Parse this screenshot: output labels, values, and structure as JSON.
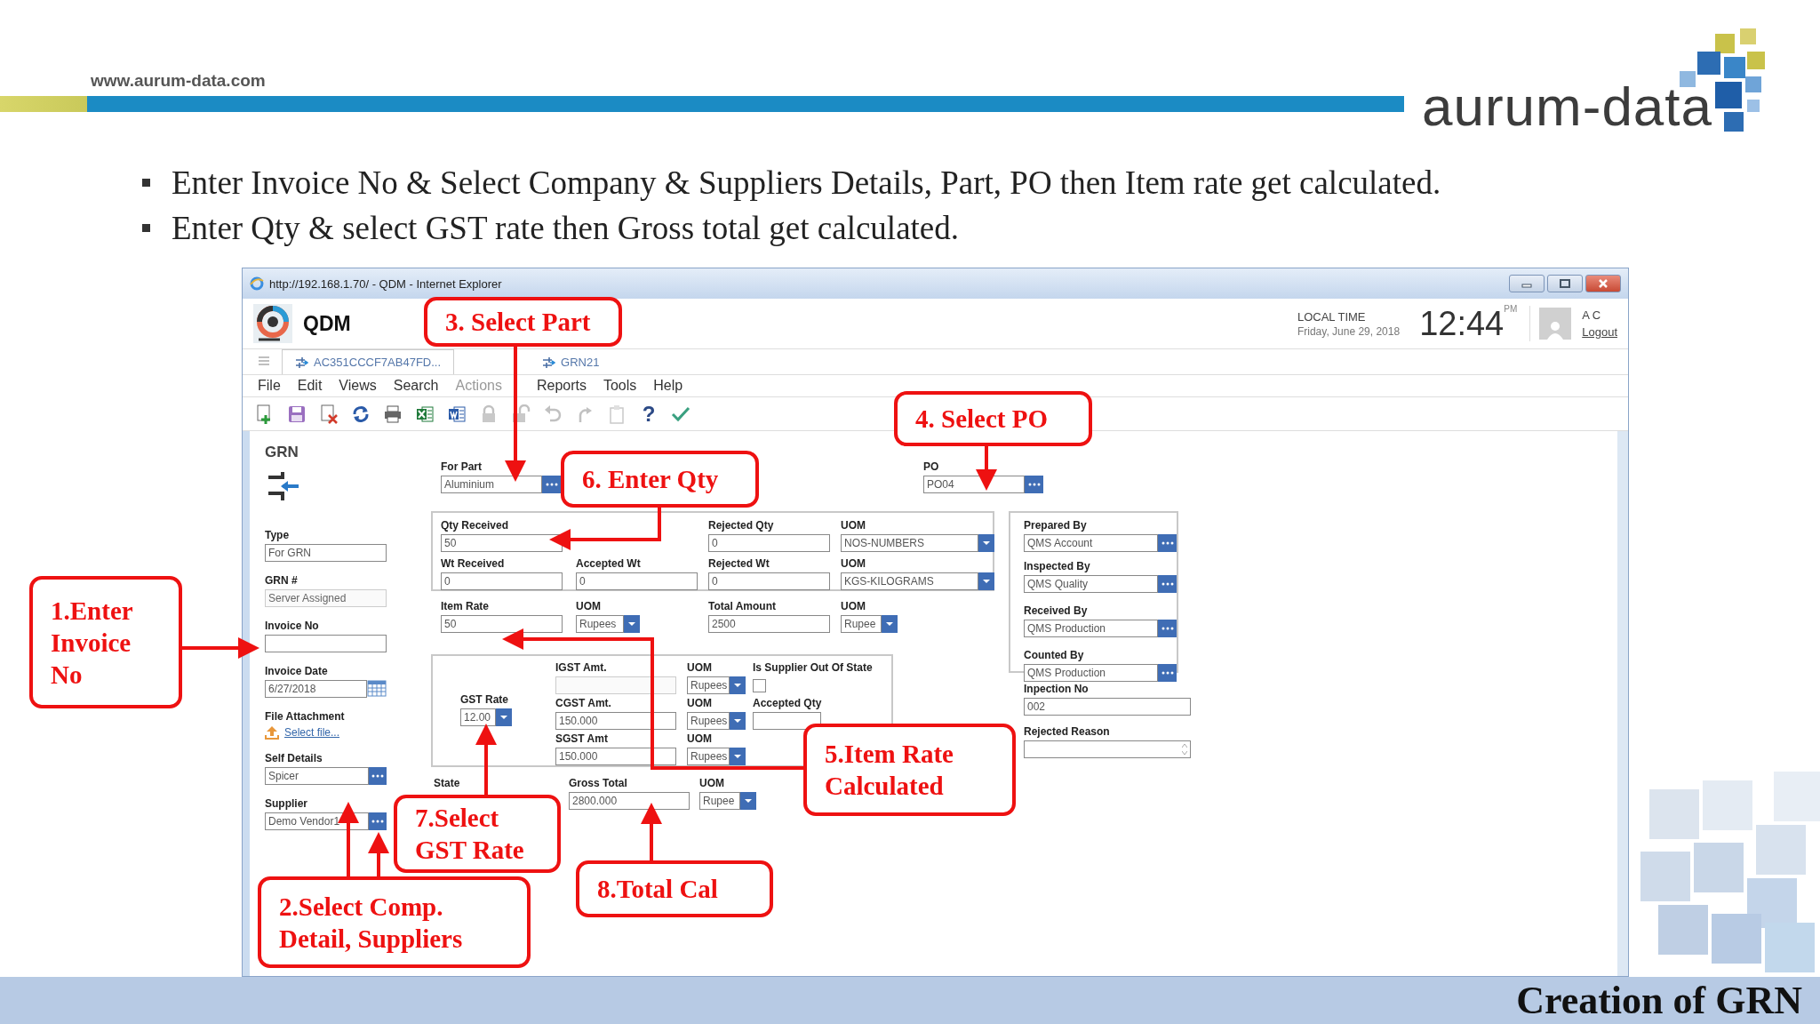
{
  "slide": {
    "site_url": "www.aurum-data.com",
    "logo_text": "aurum-data",
    "bullets": [
      "Enter Invoice No & Select Company & Suppliers Details, Part, PO then Item rate get calculated.",
      "Enter Qty & select GST rate then Gross total get calculated."
    ],
    "footer_title": "Creation of GRN"
  },
  "window": {
    "title": "http://192.168.1.70/ - QDM - Internet Explorer",
    "app_name": "QDM",
    "local_time_label": "LOCAL TIME",
    "date": "Friday, June 29, 2018",
    "time": "12:44",
    "meridiem": "PM",
    "user": "A C",
    "logout": "Logout",
    "tabs": [
      {
        "label": "AC351CCCF7AB47FD...",
        "selected": true
      },
      {
        "label": "GRN21",
        "selected": false
      }
    ],
    "menu": [
      {
        "label": "File",
        "disabled": false
      },
      {
        "label": "Edit",
        "disabled": false
      },
      {
        "label": "Views",
        "disabled": false
      },
      {
        "label": "Search",
        "disabled": false
      },
      {
        "label": "Actions",
        "disabled": true
      },
      {
        "label": "Reports",
        "disabled": false
      },
      {
        "label": "Tools",
        "disabled": false
      },
      {
        "label": "Help",
        "disabled": false
      }
    ],
    "toolbar": [
      {
        "kind": "new",
        "disabled": false
      },
      {
        "kind": "save",
        "disabled": false
      },
      {
        "kind": "delete",
        "disabled": false
      },
      {
        "kind": "refresh",
        "disabled": false
      },
      {
        "kind": "print",
        "disabled": false
      },
      {
        "kind": "excel",
        "disabled": false
      },
      {
        "kind": "word",
        "disabled": false
      },
      {
        "kind": "lock",
        "disabled": true
      },
      {
        "kind": "unlock",
        "disabled": true
      },
      {
        "kind": "undo",
        "disabled": true
      },
      {
        "kind": "redo",
        "disabled": true
      },
      {
        "kind": "paste",
        "disabled": true
      },
      {
        "kind": "help",
        "label": "?",
        "disabled": false
      },
      {
        "kind": "confirm",
        "disabled": false
      }
    ]
  },
  "form": {
    "title": "GRN",
    "left_fields": [
      {
        "label": "Type",
        "kind": "text",
        "value": "For GRN",
        "disabled": false
      },
      {
        "label": "GRN #",
        "kind": "text",
        "value": "Server Assigned",
        "disabled": true
      },
      {
        "label": "Invoice No",
        "kind": "text",
        "disabled": false
      },
      {
        "label": "Invoice Date",
        "kind": "date",
        "value": "6/27/2018"
      },
      {
        "label": "File Attachment",
        "kind": "file",
        "link": "Select file..."
      },
      {
        "label": "Self Details",
        "kind": "lookup",
        "value": "Spicer"
      },
      {
        "label": "Supplier",
        "kind": "lookup",
        "value": "Demo Vendor1"
      }
    ],
    "part": {
      "label": "For Part",
      "kind": "lookup",
      "value": "Aluminium"
    },
    "po": {
      "label": "PO",
      "kind": "lookup",
      "value": "PO04"
    },
    "quantity_box": [
      {
        "label": "Qty Received",
        "kind": "text",
        "value": "50",
        "disabled": false
      },
      {
        "label": "Rejected Qty",
        "kind": "text",
        "value": "0",
        "disabled": false
      },
      {
        "label": "UOM",
        "kind": "dropdown",
        "value": "NOS-NUMBERS"
      },
      {
        "label": "Wt Received",
        "kind": "text",
        "value": "0",
        "disabled": false
      },
      {
        "label": "Accepted Wt",
        "kind": "text",
        "value": "0",
        "disabled": false
      },
      {
        "label": "Rejected Wt",
        "kind": "text",
        "value": "0",
        "disabled": false
      },
      {
        "label": "UOM",
        "kind": "dropdown",
        "value": "KGS-KILOGRAMS"
      }
    ],
    "rate_row": [
      {
        "label": "Item Rate",
        "kind": "text",
        "value": "50",
        "disabled": false
      },
      {
        "label": "UOM",
        "kind": "dropdown",
        "value": "Rupees"
      },
      {
        "label": "Total Amount",
        "kind": "text",
        "value": "2500",
        "disabled": false
      },
      {
        "label": "UOM",
        "kind": "dropdown",
        "value": "Rupee"
      }
    ],
    "gst_box": [
      {
        "label": "IGST Amt.",
        "kind": "text",
        "disabled": true
      },
      {
        "label": "UOM",
        "kind": "dropdown",
        "value": "Rupees"
      },
      {
        "label": "Is Supplier Out Of State",
        "kind": "checkbox",
        "checked": false
      },
      {
        "label": "GST Rate",
        "kind": "dropdown",
        "value": "12.00"
      },
      {
        "label": "CGST Amt.",
        "kind": "text",
        "value": "150.000",
        "disabled": false
      },
      {
        "label": "UOM",
        "kind": "dropdown",
        "value": "Rupees"
      },
      {
        "label": "Accepted Qty",
        "kind": "text",
        "disabled": false
      },
      {
        "label": "SGST Amt",
        "kind": "text",
        "value": "150.000",
        "disabled": false
      },
      {
        "label": "UOM",
        "kind": "dropdown",
        "value": "Rupees"
      }
    ],
    "gross_row": [
      {
        "label": "State",
        "kind": "label"
      },
      {
        "label": "Gross Total",
        "kind": "text",
        "value": "2800.000",
        "disabled": false
      },
      {
        "label": "UOM",
        "kind": "dropdown",
        "value": "Rupee"
      }
    ],
    "signoff_box": [
      {
        "label": "Prepared By",
        "kind": "lookup",
        "value": "QMS Account"
      },
      {
        "label": "Inspected By",
        "kind": "lookup",
        "value": "QMS Quality"
      },
      {
        "label": "Received By",
        "kind": "lookup",
        "value": "QMS Production"
      },
      {
        "label": "Counted By",
        "kind": "lookup",
        "value": "QMS Production"
      }
    ],
    "extra_fields": [
      {
        "label": "Inpection No",
        "kind": "text",
        "value": "002",
        "disabled": false
      },
      {
        "label": "Rejected Reason",
        "kind": "textarea"
      }
    ]
  },
  "callouts": [
    {
      "text": "3. Select Part"
    },
    {
      "text": "4. Select PO"
    },
    {
      "text": "6. Enter Qty"
    },
    {
      "text": "1.Enter\nInvoice\nNo"
    },
    {
      "text": "5.Item Rate\nCalculated"
    },
    {
      "text": "7.Select\nGST Rate"
    },
    {
      "text": "2.Select Comp.\nDetail, Suppliers"
    },
    {
      "text": "8.Total Cal"
    }
  ]
}
